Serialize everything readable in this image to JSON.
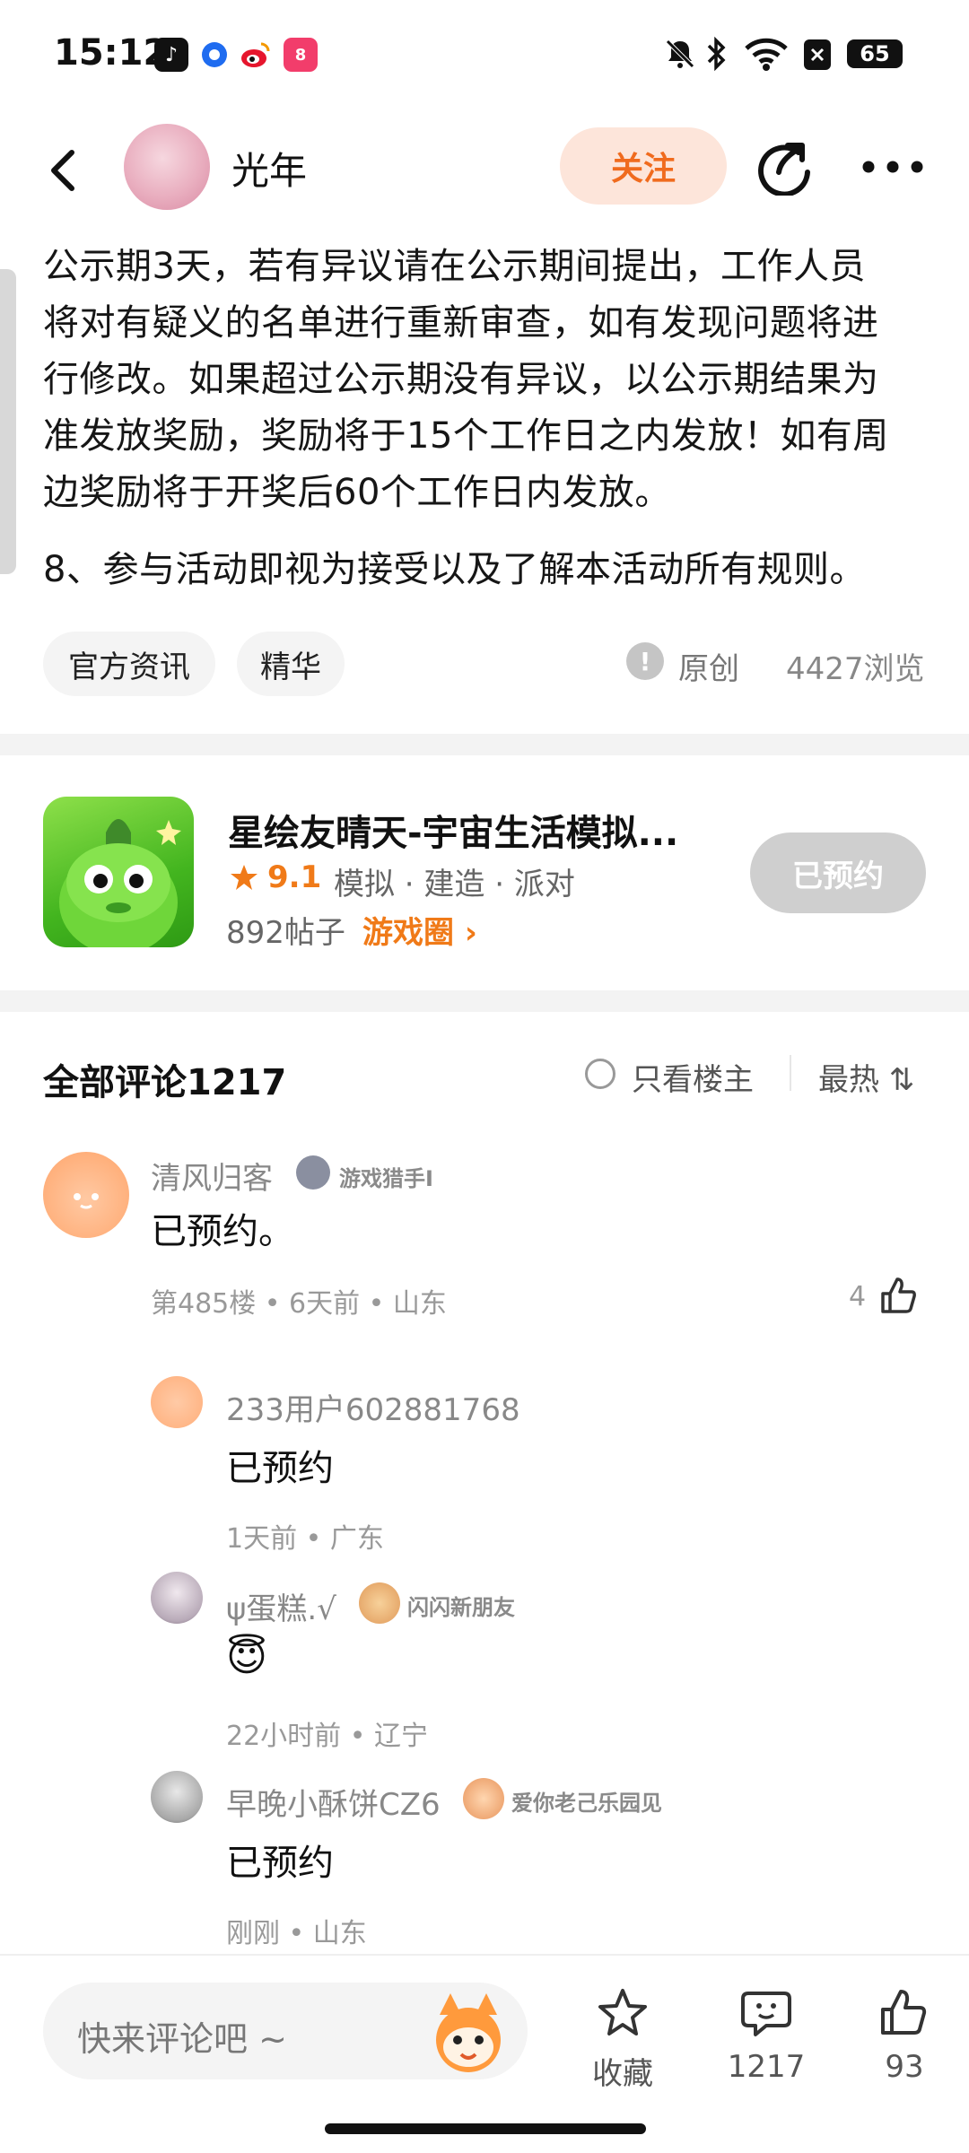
{
  "status_bar": {
    "time": "15:12",
    "battery": "65"
  },
  "header": {
    "author": "光年",
    "follow_label": "关注"
  },
  "article": {
    "paragraph_lines": [
      "公示期3天，若有异议请在公示期间提出，工作人员",
      "将对有疑义的名单进行重新审查，如有发现问题将进",
      "行修改。如果超过公示期没有异议，以公示期结果为",
      "准发放奖励，奖励将于15个工作日之内发放！如有周",
      "边奖励将于开奖后60个工作日内发放。"
    ],
    "rule8": "8、参与活动即视为接受以及了解本活动所有规则。",
    "tags": [
      "官方资讯",
      "精华"
    ],
    "original_label": "原创",
    "views": "4427浏览"
  },
  "game_card": {
    "title": "星绘友晴天-宇宙生活模拟...",
    "rating": "9.1",
    "tags": "模拟 · 建造 · 派对",
    "posts": "892帖子",
    "circle_link": "游戏圈 ›",
    "reserved_label": "已预约"
  },
  "comments": {
    "title": "全部评论1217",
    "only_owner": "只看楼主",
    "sort": "最热 ⇅",
    "main": {
      "user": "清风归客",
      "badge": "游戏猎手I",
      "text": "已预约。",
      "meta": "第485楼 • 6天前 • 山东",
      "likes": "4"
    },
    "replies": [
      {
        "user": "233用户602881768",
        "badge": "",
        "text": "已预约",
        "meta": "1天前 • 广东"
      },
      {
        "user": "ψ蛋糕.√",
        "badge": "闪闪新朋友",
        "text": "😇",
        "meta": "22小时前 • 辽宁"
      },
      {
        "user": "早晚小酥饼CZ6",
        "badge": "爱你老己乐园见",
        "text": "已预约",
        "meta": "刚刚 • 山东"
      }
    ]
  },
  "bottom_bar": {
    "placeholder": "快来评论吧 ~",
    "collect_label": "收藏",
    "comment_count": "1217",
    "like_count": "93"
  },
  "colors": {
    "accent": "#f07a18",
    "follow_bg": "#fde5da",
    "reserved_bg": "#cfcfcf"
  }
}
